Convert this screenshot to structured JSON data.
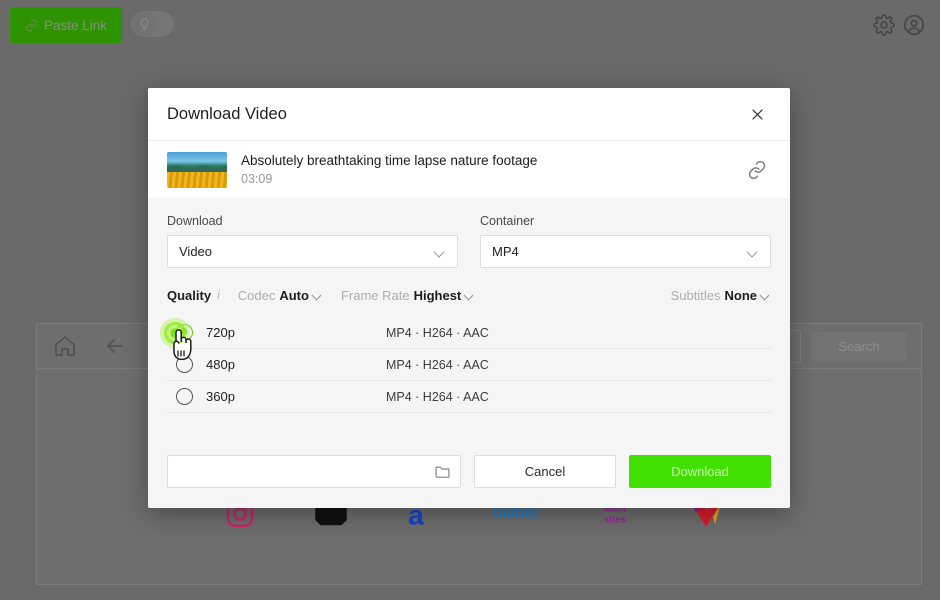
{
  "app": {
    "toolbar": {
      "paste_link_label": "Paste Link",
      "paste_link_icon": "chain-link-icon",
      "bulb_toggle_icon": "lightbulb-icon",
      "settings_icon": "gear-icon",
      "account_icon": "account-circle-icon"
    },
    "browser_bar": {
      "home_icon": "home-icon",
      "back_icon": "arrow-left-icon",
      "forward_icon": "arrow-right-icon",
      "search_label": "Search"
    },
    "site_logos": [
      {
        "name": "instagram-logo",
        "color": "#cc2366"
      },
      {
        "name": "dark-video-site-logo",
        "color": "#111111"
      },
      {
        "name": "blue-a-logo",
        "color": "#1544d6"
      },
      {
        "name": "bilibili-logo",
        "color": "#1a7fd4"
      },
      {
        "name": "adult-sites-logo",
        "color": "#a01fa0",
        "text": "adult sites"
      },
      {
        "name": "heart-logo",
        "color": "#d81d2c"
      }
    ]
  },
  "modal": {
    "title": "Download Video",
    "close_icon": "close-icon",
    "video": {
      "thumbnail_icon": "video-thumbnail",
      "title": "Absolutely breathtaking time lapse nature footage",
      "duration": "03:09",
      "link_icon": "chain-link-icon"
    },
    "download_field": {
      "label": "Download",
      "value": "Video",
      "caret_icon": "chevron-down-icon"
    },
    "container_field": {
      "label": "Container",
      "value": "MP4",
      "caret_icon": "chevron-down-icon"
    },
    "options": {
      "quality_label": "Quality",
      "quality_info_icon": "info-icon",
      "codec_label": "Codec",
      "codec_value": "Auto",
      "frame_rate_label": "Frame Rate",
      "frame_rate_value": "Highest",
      "subtitles_label": "Subtitles",
      "subtitles_value": "None"
    },
    "quality_rows": [
      {
        "label": "720p",
        "codec": "MP4 · H264 · AAC",
        "selected": true
      },
      {
        "label": "480p",
        "codec": "MP4 · H264 · AAC",
        "selected": false
      },
      {
        "label": "360p",
        "codec": "MP4 · H264 · AAC",
        "selected": false
      }
    ],
    "footer": {
      "path_value": "",
      "path_placeholder": "",
      "folder_icon": "folder-icon",
      "cancel_label": "Cancel",
      "download_label": "Download",
      "download_color": "#41e000"
    }
  },
  "cursor": {
    "type": "pointing-hand-cursor",
    "ripple_color": "#78e100",
    "target": "720p"
  }
}
